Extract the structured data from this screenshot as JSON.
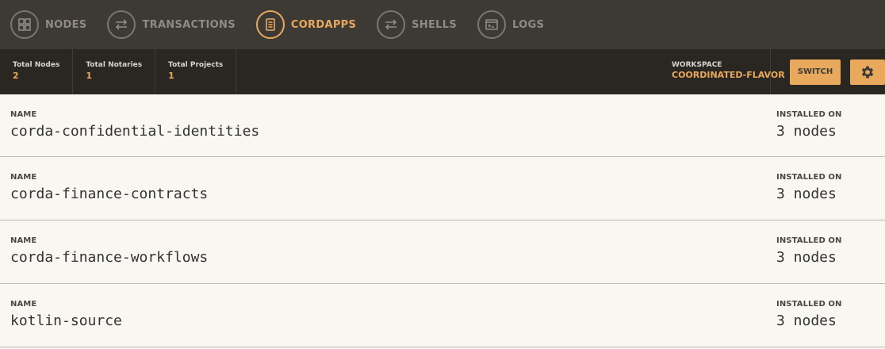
{
  "nav": {
    "items": [
      {
        "label": "NODES",
        "icon": "grid-icon"
      },
      {
        "label": "TRANSACTIONS",
        "icon": "transfer-icon"
      },
      {
        "label": "CORDAPPS",
        "icon": "document-icon"
      },
      {
        "label": "SHELLS",
        "icon": "transfer-icon"
      },
      {
        "label": "LOGS",
        "icon": "terminal-icon"
      }
    ],
    "active": "CORDAPPS"
  },
  "stats": {
    "nodes": {
      "label": "Total Nodes",
      "value": "2"
    },
    "notaries": {
      "label": "Total Notaries",
      "value": "1"
    },
    "projects": {
      "label": "Total Projects",
      "value": "1"
    }
  },
  "workspace": {
    "label": "WORKSPACE",
    "name": "COORDINATED-FLAVOR",
    "switch_label": "SWITCH",
    "settings_icon": "gear-icon"
  },
  "cordapps": {
    "name_label": "NAME",
    "installed_label": "INSTALLED ON",
    "rows": [
      {
        "name": "corda-confidential-identities",
        "installed": "3 nodes"
      },
      {
        "name": "corda-finance-contracts",
        "installed": "3 nodes"
      },
      {
        "name": "corda-finance-workflows",
        "installed": "3 nodes"
      },
      {
        "name": "kotlin-source",
        "installed": "3 nodes"
      }
    ]
  },
  "colors": {
    "accent": "#e9a95c",
    "nav_bg": "#3d3a36",
    "stats_bg": "#2a2722",
    "content_bg": "#f9f7f2"
  }
}
